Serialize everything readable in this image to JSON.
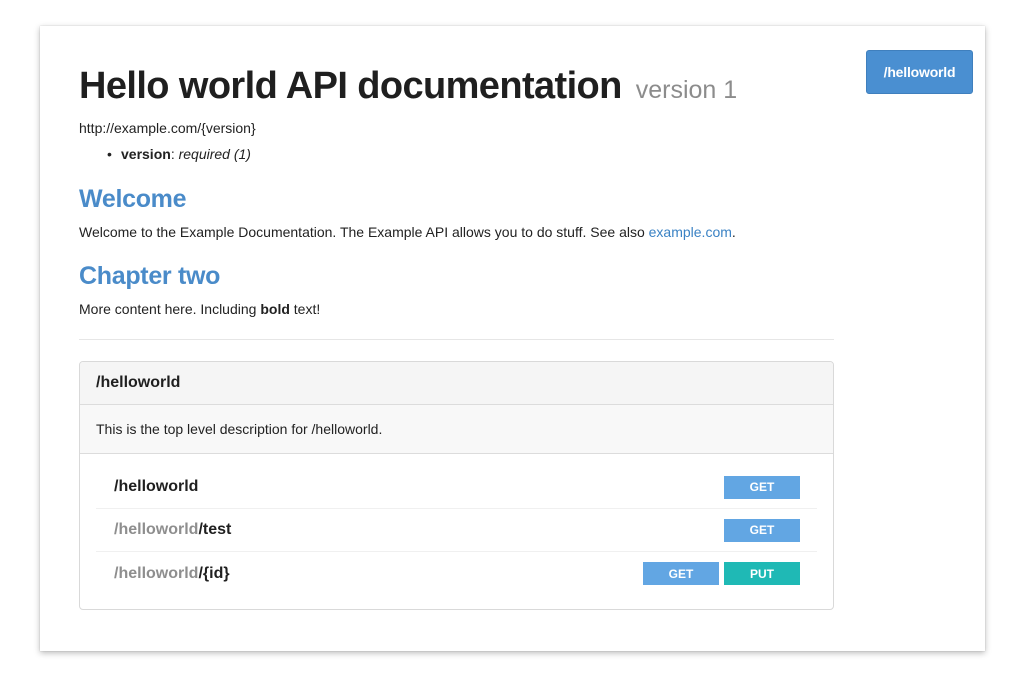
{
  "nav": {
    "button_label": "/helloworld"
  },
  "header": {
    "title": "Hello world API documentation",
    "version": "version 1",
    "base_uri": "http://example.com/{version}"
  },
  "parameters": [
    {
      "name": "version",
      "value": "required (1)"
    }
  ],
  "sections": {
    "welcome": {
      "heading": "Welcome",
      "text": "Welcome to the Example Documentation. The Example API allows you to do stuff. See also ",
      "link": "example.com",
      "after": "."
    },
    "chapter": {
      "heading": "Chapter two",
      "text_before": "More content here. Including ",
      "bold": "bold",
      "text_after": " text!"
    }
  },
  "resource": {
    "title": "/helloworld",
    "description": "This is the top level description for /helloworld.",
    "rows": [
      {
        "prefix": "",
        "path": "/helloworld",
        "methods": [
          {
            "label": "GET",
            "kind": "get"
          }
        ]
      },
      {
        "prefix": "/helloworld",
        "path": "/test",
        "methods": [
          {
            "label": "GET",
            "kind": "get"
          }
        ]
      },
      {
        "prefix": "/helloworld",
        "path": "/{id}",
        "methods": [
          {
            "label": "GET",
            "kind": "get"
          },
          {
            "label": "PUT",
            "kind": "put"
          }
        ]
      }
    ]
  },
  "colors": {
    "heading_blue": "#4a8bc9",
    "nav_button": "#4a8fd1",
    "get_button": "#62a6e3",
    "put_button": "#1fb9b5"
  }
}
